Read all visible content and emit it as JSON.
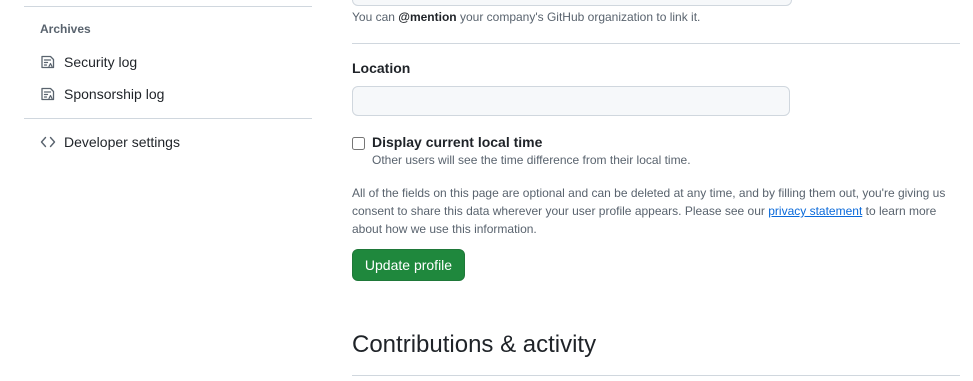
{
  "sidebar": {
    "archives_heading": "Archives",
    "items": [
      {
        "label": "Security log",
        "icon": "log-icon"
      },
      {
        "label": "Sponsorship log",
        "icon": "log-icon"
      },
      {
        "label": "Developer settings",
        "icon": "code-icon"
      }
    ]
  },
  "profile": {
    "company_hint_prefix": "You can ",
    "company_hint_mention": "@mention",
    "company_hint_suffix": " your company's GitHub organization to link it.",
    "location_label": "Location",
    "location_value": "",
    "display_time_label": "Display current local time",
    "display_time_note": "Other users will see the time difference from their local time.",
    "display_time_checked": false,
    "disclaimer_prefix": "All of the fields on this page are optional and can be deleted at any time, and by filling them out, you're giving us consent to share this data wherever your user profile appears. Please see our ",
    "disclaimer_link": "privacy statement",
    "disclaimer_suffix": " to learn more about how we use this information.",
    "update_button": "Update profile"
  },
  "contributions": {
    "title": "Contributions & activity"
  },
  "colors": {
    "primary_button": "#1f883d",
    "link": "#0969da",
    "border": "#d0d7de",
    "muted_text": "#59636e"
  }
}
